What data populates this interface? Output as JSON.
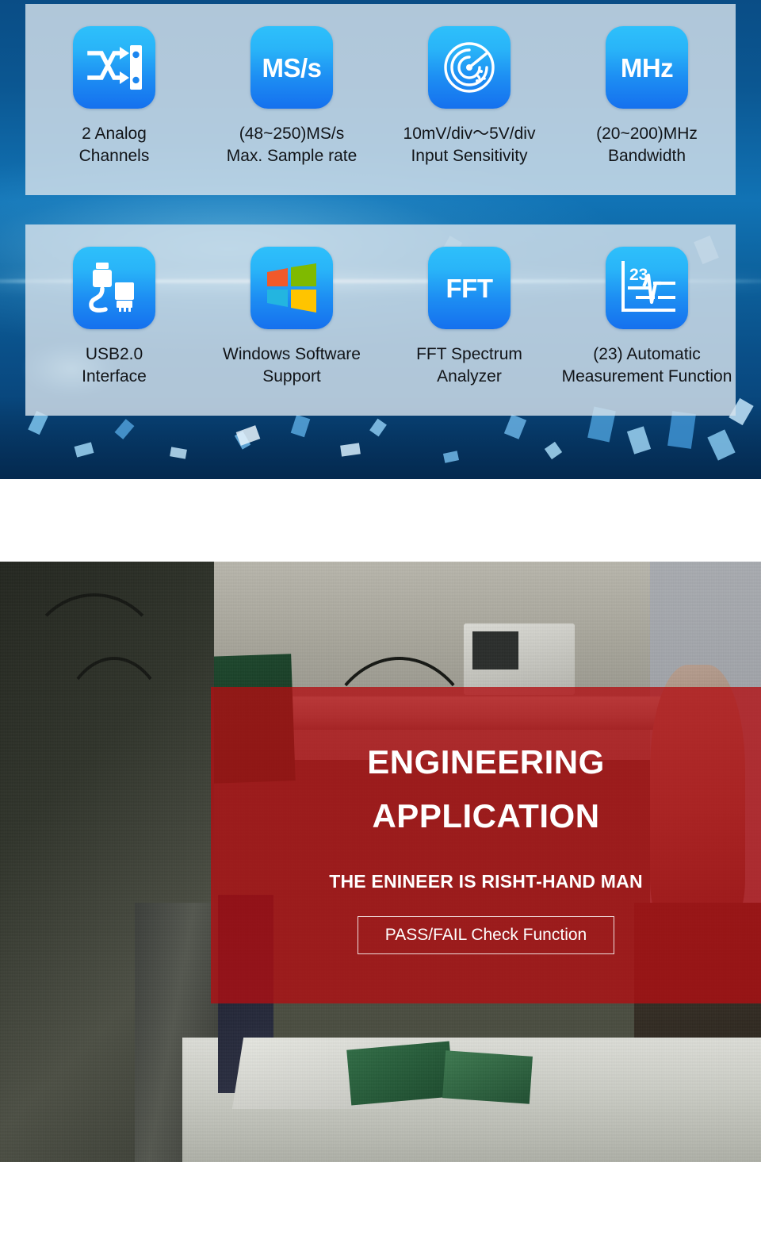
{
  "hero": {
    "panels": [
      {
        "name": "specs-panel",
        "features": [
          {
            "icon": "shuffle-channels-icon",
            "icon_text": "",
            "label": "2 Analog\nChannels"
          },
          {
            "icon": "sample-rate-icon",
            "icon_text": "MS/s",
            "label": "(48~250)MS/s\nMax. Sample rate"
          },
          {
            "icon": "radar-sensitivity-icon",
            "icon_text": "",
            "label": "10mV/div～5V/div\nInput Sensitivity"
          },
          {
            "icon": "bandwidth-icon",
            "icon_text": "MHz",
            "label": "(20~200)MHz\nBandwidth"
          }
        ]
      },
      {
        "name": "capabilities-panel",
        "features": [
          {
            "icon": "usb-cable-icon",
            "icon_text": "",
            "label": "USB2.0\nInterface"
          },
          {
            "icon": "windows-logo-icon",
            "icon_text": "",
            "label": "Windows Software\nSupport"
          },
          {
            "icon": "fft-icon",
            "icon_text": "FFT",
            "label": "FFT Spectrum\nAnalyzer"
          },
          {
            "icon": "auto-measure-icon",
            "icon_text": "23",
            "label": "(23) Automatic\nMeasurement Function"
          }
        ]
      }
    ]
  },
  "application": {
    "section_name": "engineering-application-photo",
    "overlay": {
      "title_line1": "ENGINEERING",
      "title_line2": "APPLICATION",
      "subtitle": "THE ENINEER IS RISHT-HAND MAN",
      "button_label": "PASS/FAIL Check Function"
    }
  },
  "colors": {
    "hero_blue_dark": "#06396a",
    "hero_blue_mid": "#1173b5",
    "panel_bg": "#d6e2eb",
    "icon_blue_top": "#2ec0fb",
    "icon_blue_bottom": "#1570ee",
    "overlay_red": "#b20e12",
    "text_dark": "#111418",
    "text_white": "#ffffff",
    "win_orange": "#f1592a",
    "win_green": "#7fba00",
    "win_cyan": "#23b5e0",
    "win_yellow": "#ffc400"
  }
}
